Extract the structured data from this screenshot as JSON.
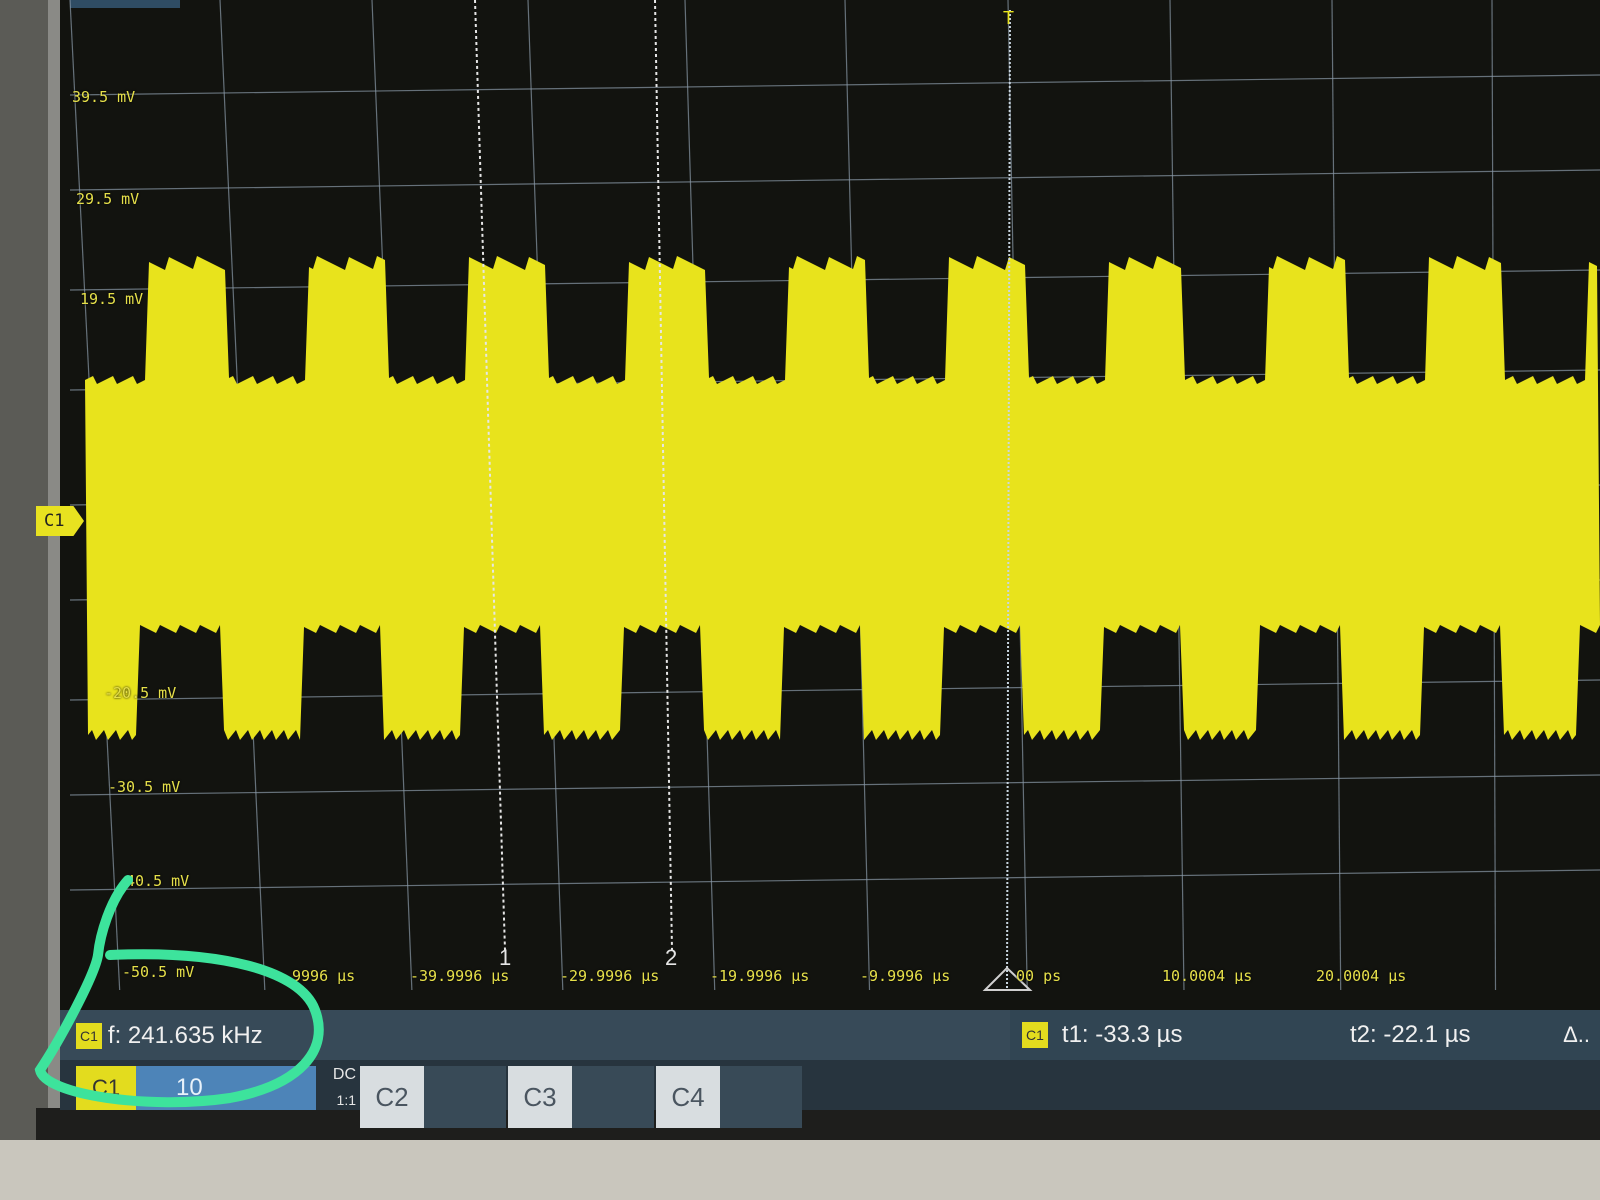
{
  "y_labels": [
    "39.5 mV",
    "29.5 mV",
    "19.5 mV",
    "-20.5 mV",
    "-30.5 mV",
    "40.5 mV",
    "-50.5 mV"
  ],
  "x_labels": [
    "9996 µs",
    "-39.9996 µs",
    "-29.9996 µs",
    "-19.9996 µs",
    "-9.9996 µs",
    "00 ps",
    "10.0004 µs",
    "20.0004 µs"
  ],
  "channel_marker": "C1",
  "trigger_marker": "T",
  "cursors": {
    "c1": "1",
    "c2": "2"
  },
  "measurement": {
    "badge": "C1",
    "frequency": "f: 241.635 kHz"
  },
  "cursor_readout": {
    "badge": "C1",
    "t1": "t1: -33.3 µs",
    "t2": "t2: -22.1 µs",
    "delta": "Δ.."
  },
  "channel_bar": {
    "c1_label": "C1",
    "c1_scale": "10",
    "c1_coupling": "DC",
    "c1_probe": "1:1",
    "c2_label": "C2",
    "c3_label": "C3",
    "c4_label": "C4"
  },
  "colors": {
    "trace": "#e8e31c",
    "grid": "#8a9aa8",
    "annotation": "#3de39c"
  }
}
